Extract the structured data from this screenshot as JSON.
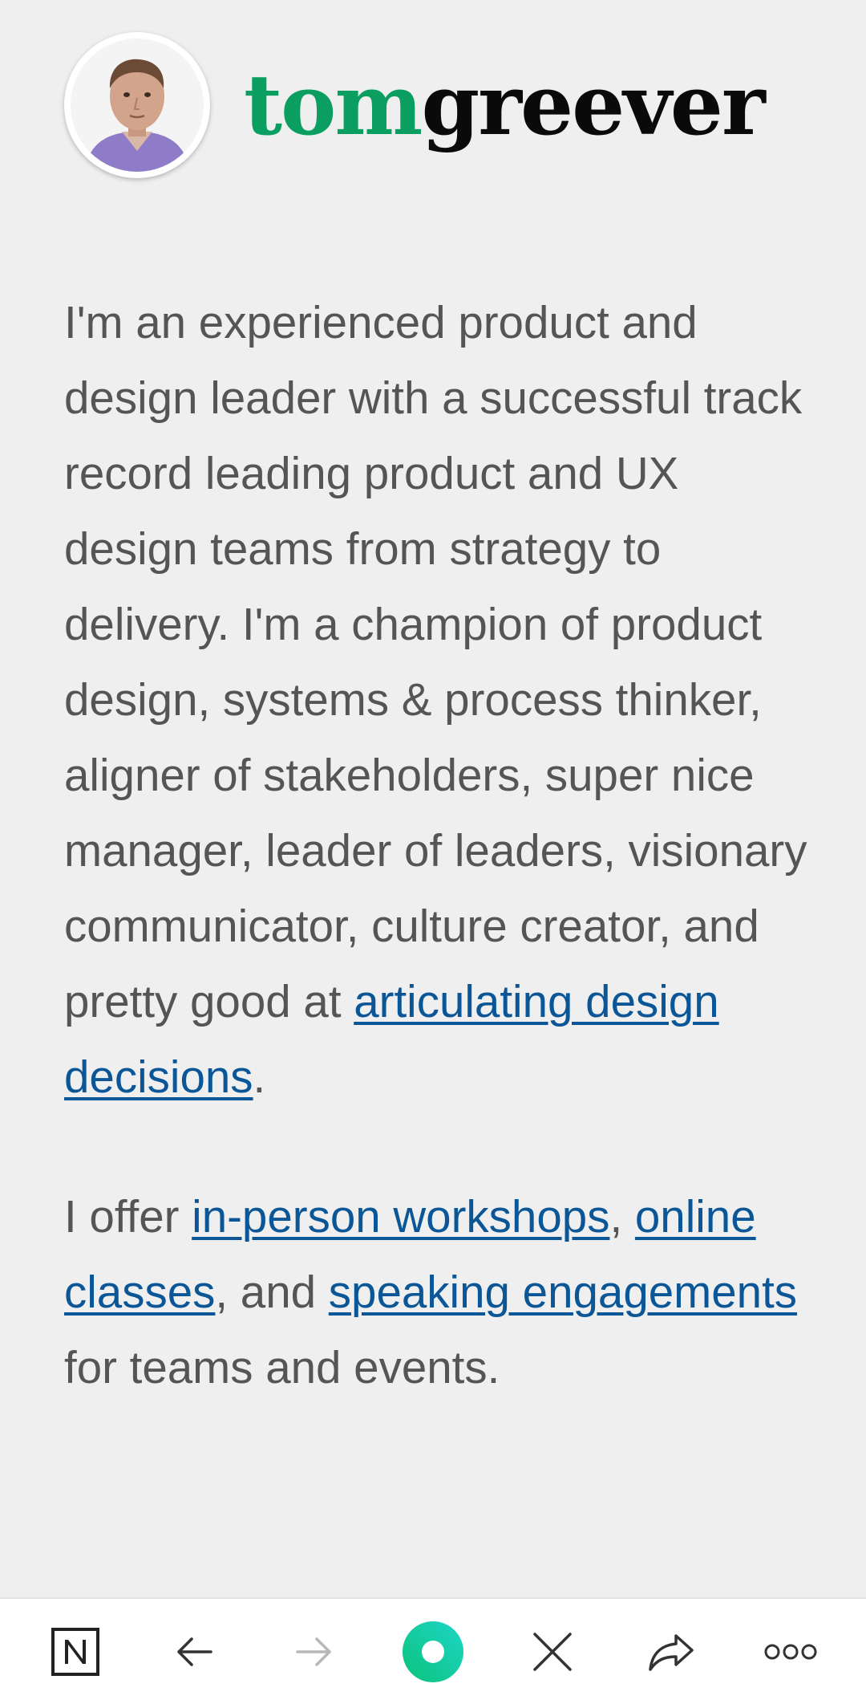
{
  "site": {
    "brand_first": "tom",
    "brand_last": "greever",
    "avatar_alt": "Tom Greever portrait"
  },
  "intro": {
    "text": "I'm an experienced product and design leader with a successful track record leading product and UX design teams from strategy to delivery. I'm a champion of product design, systems & process thinker, aligner of stakeholders, super nice manager, leader of leaders, visionary communicator, culture creator, and pretty good at ",
    "link_label": "articulating design decisions",
    "tail": "."
  },
  "offer": {
    "prefix": "I offer ",
    "workshops_link": "in-person workshops",
    "sep1": ", ",
    "classes_link": "online classes",
    "sep2": ", and ",
    "speaking_link": "speaking engagements",
    "suffix": " for teams and events."
  },
  "toolbar": {
    "icons": [
      "notion-icon",
      "back-arrow-icon",
      "forward-arrow-icon",
      "home-circle-icon",
      "close-icon",
      "share-icon",
      "more-icon"
    ]
  },
  "colors": {
    "brand_green": "#0a9e60",
    "link_blue": "#0b5696",
    "body_text": "#555555",
    "background": "#efeff0"
  }
}
